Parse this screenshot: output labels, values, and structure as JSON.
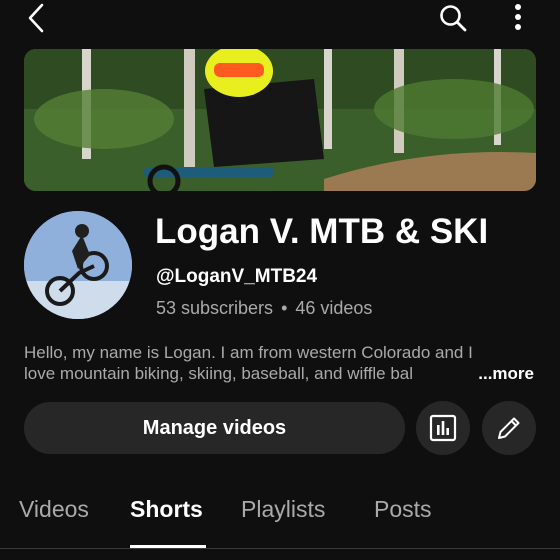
{
  "header": {
    "back_icon": "back-arrow-icon",
    "search_icon": "search-icon",
    "more_icon": "more-vertical-icon"
  },
  "channel": {
    "name": "Logan V. MTB & SKI",
    "handle": "@LoganV_MTB24",
    "subscribers": "53 subscribers",
    "separator": "•",
    "videos": "46 videos",
    "description_line1": "Hello, my name is Logan. I am from western Colorado and I",
    "description_line2": "love mountain biking, skiing, baseball, and wiffle bal",
    "more_label": "...more"
  },
  "actions": {
    "manage_label": "Manage videos",
    "analytics_icon": "analytics-icon",
    "edit_icon": "pencil-icon"
  },
  "tabs": [
    {
      "label": "Videos",
      "active": false
    },
    {
      "label": "Shorts",
      "active": true
    },
    {
      "label": "Playlists",
      "active": false
    },
    {
      "label": "Posts",
      "active": false
    }
  ],
  "colors": {
    "background": "#0f0f0f",
    "surface": "#272727",
    "secondary_text": "#aaaaaa",
    "primary_text": "#ffffff"
  }
}
